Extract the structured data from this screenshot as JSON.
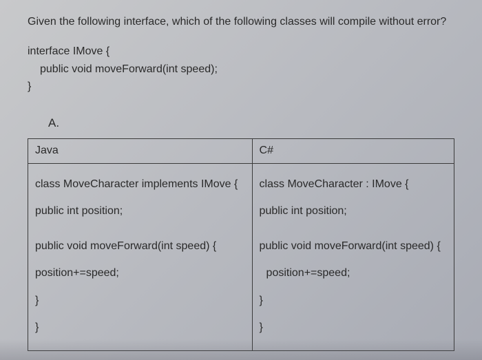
{
  "question": "Given the following interface, which of the following classes will compile without error?",
  "interface_code": {
    "line1": "interface IMove {",
    "line2": "public void moveForward(int speed);",
    "line3": "}"
  },
  "option": {
    "label": "A."
  },
  "table": {
    "headers": {
      "left": "Java",
      "right": "C#"
    },
    "java_code": {
      "line1": "class MoveCharacter implements IMove {",
      "line2": "public int position;",
      "line3": "public void moveForward(int speed) {",
      "line4": "position+=speed;",
      "line5": "}",
      "line6": "}"
    },
    "csharp_code": {
      "line1": "class MoveCharacter : IMove {",
      "line2": "public int position;",
      "line3": "public void moveForward(int speed) {",
      "line4": "position+=speed;",
      "line5": "}",
      "line6": "}"
    }
  }
}
